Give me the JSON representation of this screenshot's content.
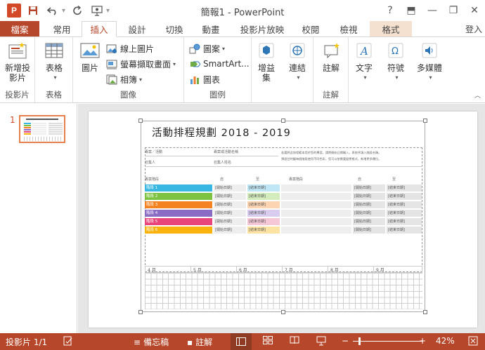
{
  "window": {
    "title": "簡報1 - PowerPoint",
    "app_letter": "P",
    "help": "?",
    "minimize": "—",
    "restore": "❐",
    "close": "✕",
    "ribbon_opts": "⬒"
  },
  "tabs": {
    "file": "檔案",
    "home": "常用",
    "insert": "插入",
    "design": "設計",
    "transitions": "切換",
    "animations": "動畫",
    "slideshow": "投影片放映",
    "review": "校閱",
    "view": "檢視",
    "format": "格式",
    "login": "登入"
  },
  "ribbon": {
    "new_slide_l1": "新增投",
    "new_slide_l2": "影片",
    "grp_slides": "投影片",
    "table": "表格",
    "grp_table": "表格",
    "picture": "圖片",
    "online_pic": "線上圖片",
    "screenshot": "螢幕擷取畫面",
    "album": "相簿",
    "grp_images": "圖像",
    "shapes": "圖案",
    "smartart": "SmartArt...",
    "chart": "圖表",
    "grp_illustrations": "圖例",
    "addins_l1": "增益",
    "addins_l2": "集",
    "links": "連結",
    "comment": "註解",
    "grp_comments": "註解",
    "text": "文字",
    "symbols": "符號",
    "media": "多媒體"
  },
  "thumbpane": {
    "slide_number": "1"
  },
  "slide": {
    "title": "活動排程規劃 2018 - 2019",
    "lbl_project": "專案／活動",
    "lbl_project_name": "專案或活動名稱",
    "lbl_person": "召集人",
    "lbl_person_name": "召集人姓名",
    "note_line1": "若要將此排程範本用於您的專案，請將開始日期輸入，再依序填入階段名稱。",
    "note_line2": "預設甘特圖每個階段使用不同色彩，您可以依需要變更格式，新增更多欄位。",
    "col_phase": "專案階段",
    "col_start": "自",
    "col_end": "至",
    "col_phase2": "專案階段",
    "col_start2": "自",
    "col_end2": "至",
    "phases": [
      "階段 1",
      "階段 2",
      "階段 3",
      "階段 4",
      "階段 5",
      "階段 6"
    ],
    "date_placeholder": "[開始日期]",
    "end_placeholder": "[結束日期]",
    "months": [
      "4 月",
      "5 月",
      "6 月",
      "7 月",
      "8 月",
      "9 月"
    ]
  },
  "status": {
    "slide_count": "投影片 1/1",
    "notes": "備忘稿",
    "comments": "註解",
    "zoom": "42%"
  },
  "colors": {
    "accent": "#b7472a",
    "phase_colors": [
      "#38b7e3",
      "#7dc241",
      "#f58220",
      "#8a6cc5",
      "#e8457a",
      "#f9b20e"
    ],
    "phase_light": [
      "#bfe6f4",
      "#d4ecbc",
      "#fcd4b2",
      "#d8cdee",
      "#f6c7d6",
      "#fde3a3"
    ]
  }
}
